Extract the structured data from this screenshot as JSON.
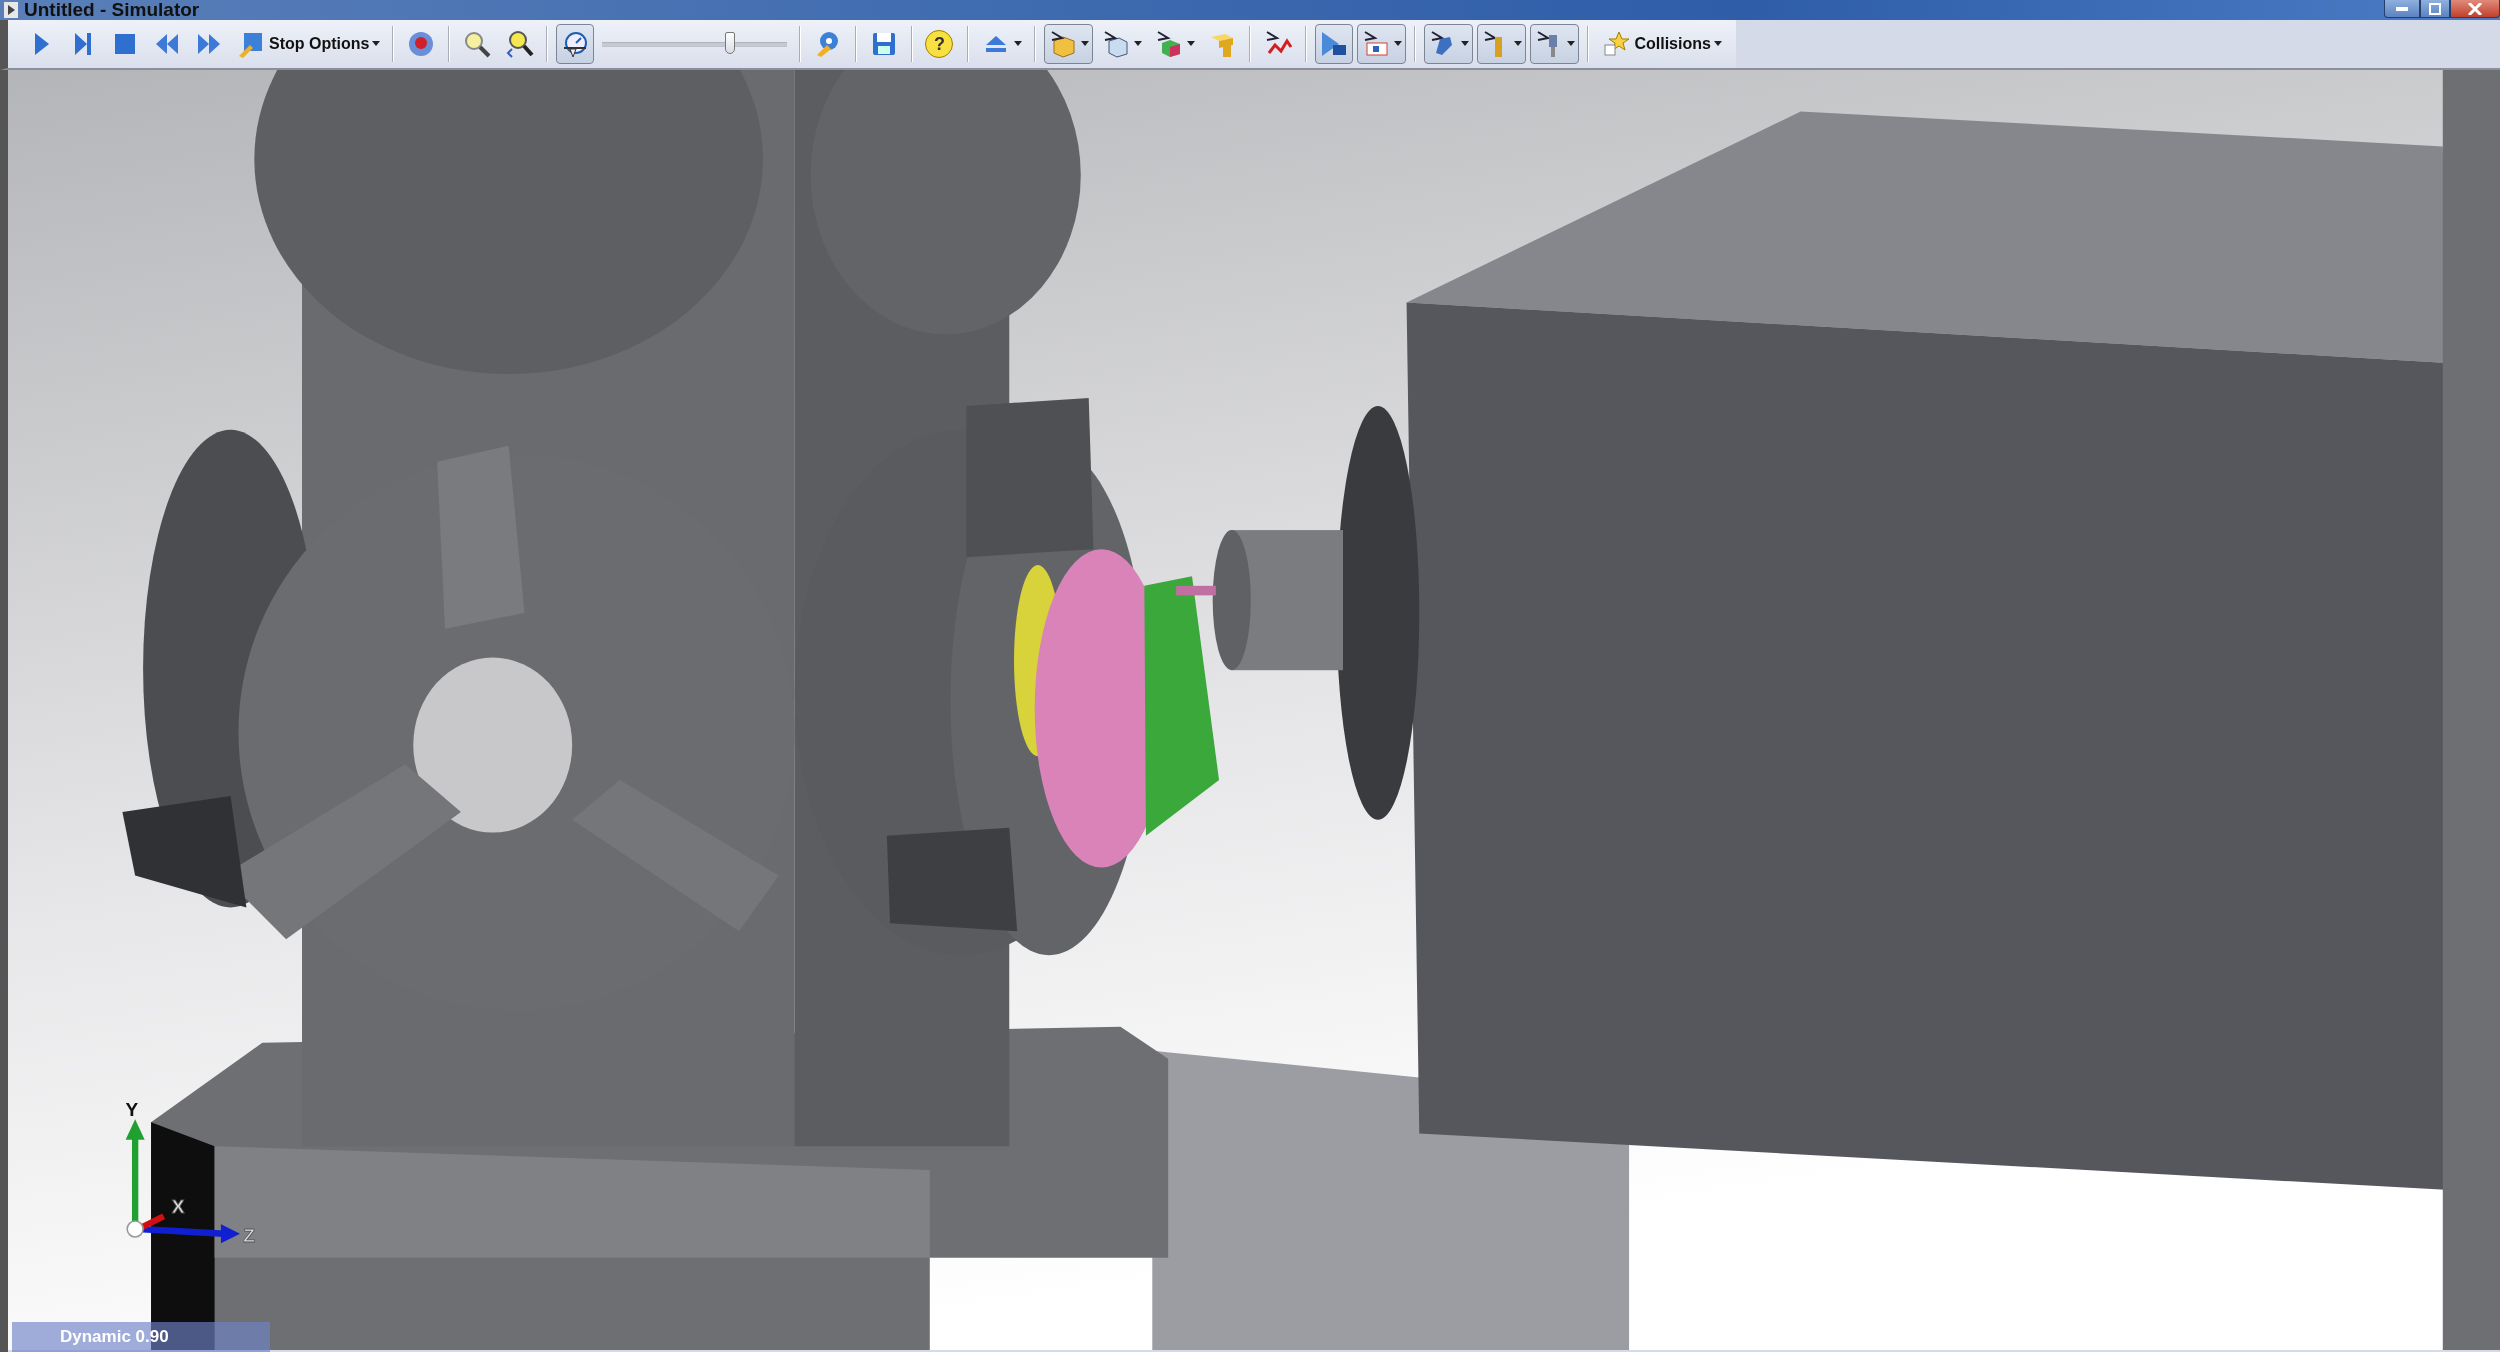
{
  "window": {
    "title": "Untitled - Simulator"
  },
  "toolbar": {
    "items": [
      {
        "kind": "button",
        "pressed": false,
        "dropdown": false
      },
      {
        "kind": "button",
        "pressed": false,
        "dropdown": false
      },
      {
        "kind": "button",
        "pressed": false,
        "dropdown": false
      },
      {
        "kind": "button",
        "pressed": false,
        "dropdown": false
      },
      {
        "kind": "button",
        "pressed": false,
        "dropdown": false
      },
      {
        "kind": "text",
        "label": "Stop Options",
        "dropdown": true
      },
      {
        "kind": "separator"
      },
      {
        "kind": "button",
        "pressed": false,
        "dropdown": false
      },
      {
        "kind": "separator"
      },
      {
        "kind": "button",
        "pressed": false,
        "dropdown": false
      },
      {
        "kind": "button",
        "pressed": false,
        "dropdown": false
      },
      {
        "kind": "separator"
      },
      {
        "kind": "button",
        "pressed": true,
        "dropdown": false
      },
      {
        "kind": "slider",
        "level": 0.7
      },
      {
        "kind": "separator"
      },
      {
        "kind": "button",
        "pressed": false,
        "dropdown": false
      },
      {
        "kind": "separator"
      },
      {
        "kind": "button",
        "pressed": false,
        "dropdown": false
      },
      {
        "kind": "separator"
      },
      {
        "kind": "button",
        "pressed": false,
        "dropdown": false,
        "glyph": "?"
      },
      {
        "kind": "separator"
      },
      {
        "kind": "button",
        "pressed": false,
        "dropdown": true
      },
      {
        "kind": "separator"
      },
      {
        "kind": "button",
        "pressed": true,
        "dropdown": true
      },
      {
        "kind": "button",
        "pressed": false,
        "dropdown": true
      },
      {
        "kind": "button",
        "pressed": false,
        "dropdown": true
      },
      {
        "kind": "button",
        "pressed": false,
        "dropdown": false
      },
      {
        "kind": "separator"
      },
      {
        "kind": "button",
        "pressed": false,
        "dropdown": false
      },
      {
        "kind": "separator"
      },
      {
        "kind": "button",
        "pressed": true,
        "dropdown": false
      },
      {
        "kind": "button",
        "pressed": true,
        "dropdown": true
      },
      {
        "kind": "separator"
      },
      {
        "kind": "button",
        "pressed": true,
        "dropdown": true
      },
      {
        "kind": "button",
        "pressed": true,
        "dropdown": true
      },
      {
        "kind": "button",
        "pressed": true,
        "dropdown": true
      },
      {
        "kind": "separator"
      },
      {
        "kind": "text",
        "label": "Collisions",
        "dropdown": true
      }
    ]
  },
  "viewport": {
    "axis_labels": {
      "y": "Y",
      "x": "X",
      "z": "Z"
    }
  },
  "status": {
    "mode": "Dynamic 0.90"
  }
}
